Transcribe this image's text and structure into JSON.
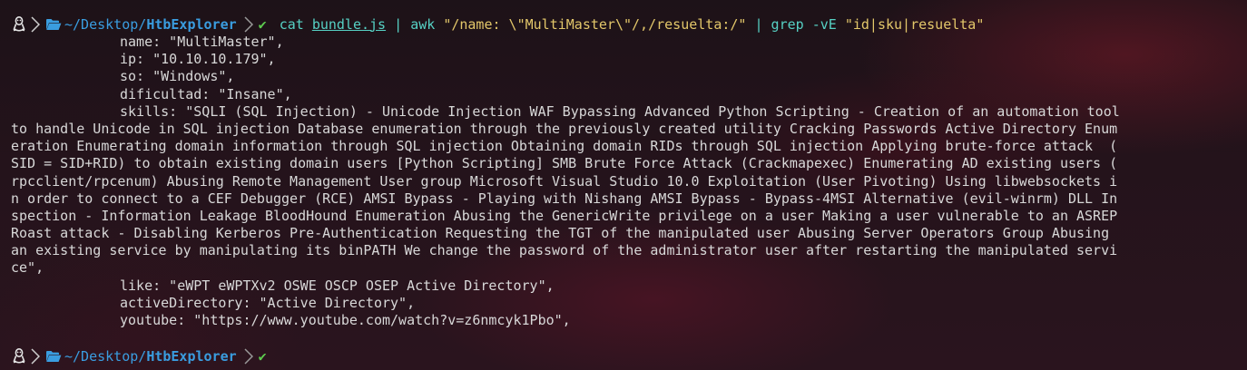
{
  "prompt": {
    "path_base": "~/Desktop/",
    "path_current": "HtbExplorer",
    "status_icon": "✔"
  },
  "command": {
    "program": "cat",
    "file": "bundle.js",
    "pipe1": "|",
    "awk": "awk",
    "awk_arg": "\"/name: \\\"MultiMaster\\\"/,/resuelta:/\"",
    "pipe2": "|",
    "grep": "grep",
    "grep_flags": "-vE",
    "grep_arg": "\"id|sku|resuelta\""
  },
  "output": {
    "name_line": "name: \"MultiMaster\",",
    "ip_line": "ip: \"10.10.10.179\",",
    "so_line": "so: \"Windows\",",
    "dificultad_line": "dificultad: \"Insane\",",
    "skills_lines": [
      "skills: \"SQLI (SQL Injection) - Unicode Injection WAF Bypassing Advanced Python Scripting - Creation of an automation tool",
      "to handle Unicode in SQL injection Database enumeration through the previously created utility Cracking Passwords Active Directory Enum",
      "eration Enumerating domain information through SQL injection Obtaining domain RIDs through SQL injection Applying brute-force attack  (",
      "SID = SID+RID) to obtain existing domain users [Python Scripting] SMB Brute Force Attack (Crackmapexec) Enumerating AD existing users (",
      "rpcclient/rpcenum) Abusing Remote Management User group Microsoft Visual Studio 10.0 Exploitation (User Pivoting) Using libwebsockets i",
      "n order to connect to a CEF Debugger (RCE) AMSI Bypass - Playing with Nishang AMSI Bypass - Bypass-4MSI Alternative (evil-winrm) DLL In",
      "spection - Information Leakage BloodHound Enumeration Abusing the GenericWrite privilege on a user Making a user vulnerable to an ASREP",
      "Roast attack - Disabling Kerberos Pre-Authentication Requesting the TGT of the manipulated user Abusing Server Operators Group Abusing",
      "an existing service by manipulating its binPATH We change the password of the administrator user after restarting the manipulated servi",
      "ce\","
    ],
    "like_line": "like: \"eWPT eWPTXv2 OSWE OSCP OSEP Active Directory\",",
    "ad_line": "activeDirectory: \"Active Directory\",",
    "youtube_line": "youtube: \"https://www.youtube.com/watch?v=z6nmcyk1Pbo\","
  },
  "colors": {
    "path": "#3a9de0",
    "command": "#56d1c4",
    "string": "#e3c76a",
    "check": "#5dcc4f",
    "text": "#d8d8d8"
  }
}
